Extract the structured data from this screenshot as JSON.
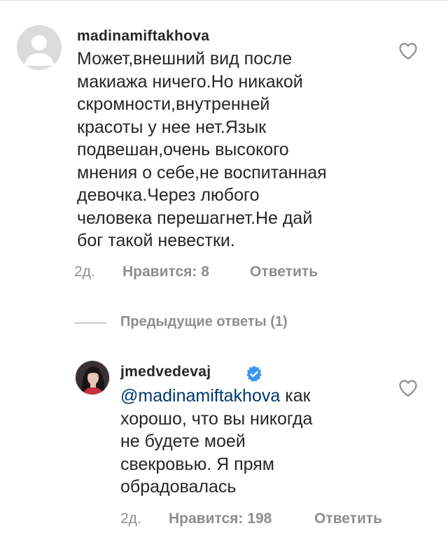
{
  "parent_comment": {
    "username": "madinamiftakhova",
    "text_lines": [
      "Может,внешний вид после",
      "макиажа ничего.Но никакой",
      "скромности,внутренней",
      "красоты у нее нет.Язык",
      "подвешан,очень высокого",
      "мнения о себе,не воспитанная",
      "девочка.Через любого",
      "человека перешагнет.Не дай",
      "бог такой невестки."
    ],
    "time": "2д.",
    "likes": "Нравится: 8",
    "reply": "Ответить"
  },
  "view_replies": "Предыдущие ответы (1)",
  "reply_comment": {
    "username": "jmedvedevaj",
    "mention": "@madinamiftakhova",
    "text_first_line_rest": " как",
    "text_lines": [
      "хорошо, что вы никогда",
      "не будете моей",
      "свекровью. Я прям",
      "обрадовалась"
    ],
    "time": "2д.",
    "likes": "Нравится: 198",
    "reply": "Ответить"
  },
  "colors": {
    "text": "#262626",
    "secondary": "#8e8e8e",
    "mention": "#00376b",
    "verified": "#3897f0"
  },
  "icons": [
    "heart-icon",
    "verified-badge-icon",
    "default-avatar-icon"
  ]
}
